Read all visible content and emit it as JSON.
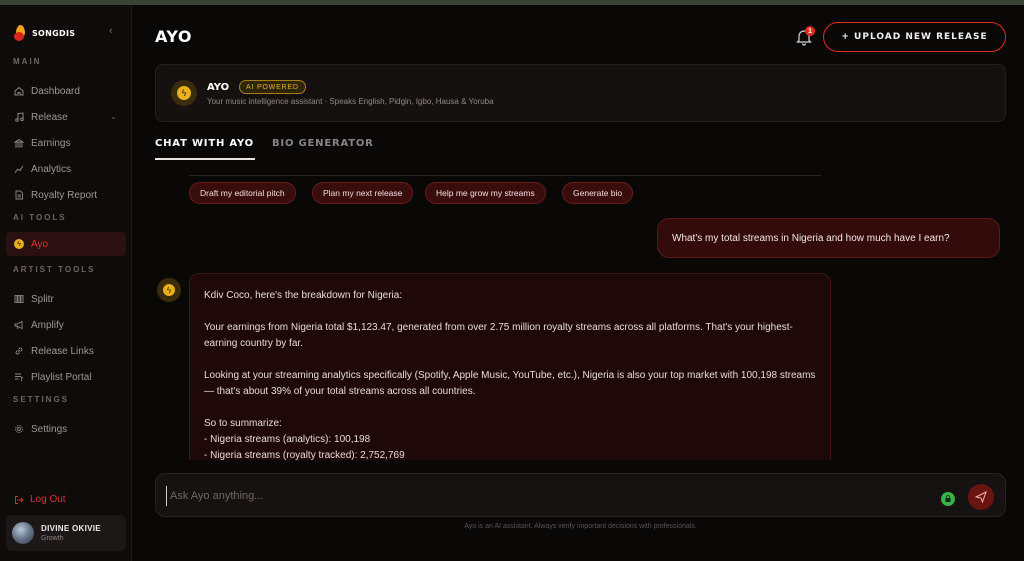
{
  "brand": {
    "name": "SONGDIS"
  },
  "sidebar": {
    "sections": {
      "main": "MAIN",
      "ai_tools": "AI TOOLS",
      "artist_tools": "ARTIST TOOLS",
      "settings": "SETTINGS"
    },
    "items": {
      "dashboard": "Dashboard",
      "release": "Release",
      "earnings": "Earnings",
      "analytics": "Analytics",
      "royalty_report": "Royalty Report",
      "ayo": "Ayo",
      "splitr": "Splitr",
      "amplify": "Amplify",
      "release_links": "Release Links",
      "playlist_portal": "Playlist Portal",
      "settings": "Settings"
    },
    "active_item": "ayo",
    "logout": "Log Out",
    "user": {
      "name": "DIVINE OKIVIE",
      "tier": "Growth"
    }
  },
  "header": {
    "title": "AYO",
    "notification_count": "1",
    "upload_label": "+ UPLOAD NEW RELEASE"
  },
  "assistant": {
    "name": "AYO",
    "badge": "AI POWERED",
    "description": "Your music intelligence assistant · Speaks English, Pidgin, Igbo, Hausa & Yoruba"
  },
  "tabs": {
    "chat": "CHAT WITH AYO",
    "bio": "BIO GENERATOR",
    "active": "chat"
  },
  "chips": [
    "Draft my editorial pitch",
    "Plan my next release",
    "Help me grow my streams",
    "Generate bio"
  ],
  "messages": {
    "user": "What's my total streams in Nigeria and how much have I earn?",
    "bot": {
      "greeting": "Kdiv Coco, here's the breakdown for Nigeria:",
      "p1": "Your earnings from Nigeria total $1,123.47, generated from over 2.75 million royalty streams across all platforms. That's your highest-earning country by far.",
      "p2": "Looking at your streaming analytics specifically (Spotify, Apple Music, YouTube, etc.), Nigeria is also your top market with 100,198 streams — that's about 39% of your total streams across all countries.",
      "summary_title": "So to summarize:",
      "bullet1": "- Nigeria streams (analytics): 100,198",
      "bullet2": "- Nigeria streams (royalty tracked): 2,752,769"
    }
  },
  "input": {
    "placeholder": "Ask Ayo anything..."
  },
  "footnote": "Ayo is an AI assistant. Always verify important decisions with professionals.",
  "colors": {
    "accent": "#e12c22",
    "gold": "#e8b11c",
    "background": "#0a0707",
    "sidebar": "#0f0b0b"
  }
}
